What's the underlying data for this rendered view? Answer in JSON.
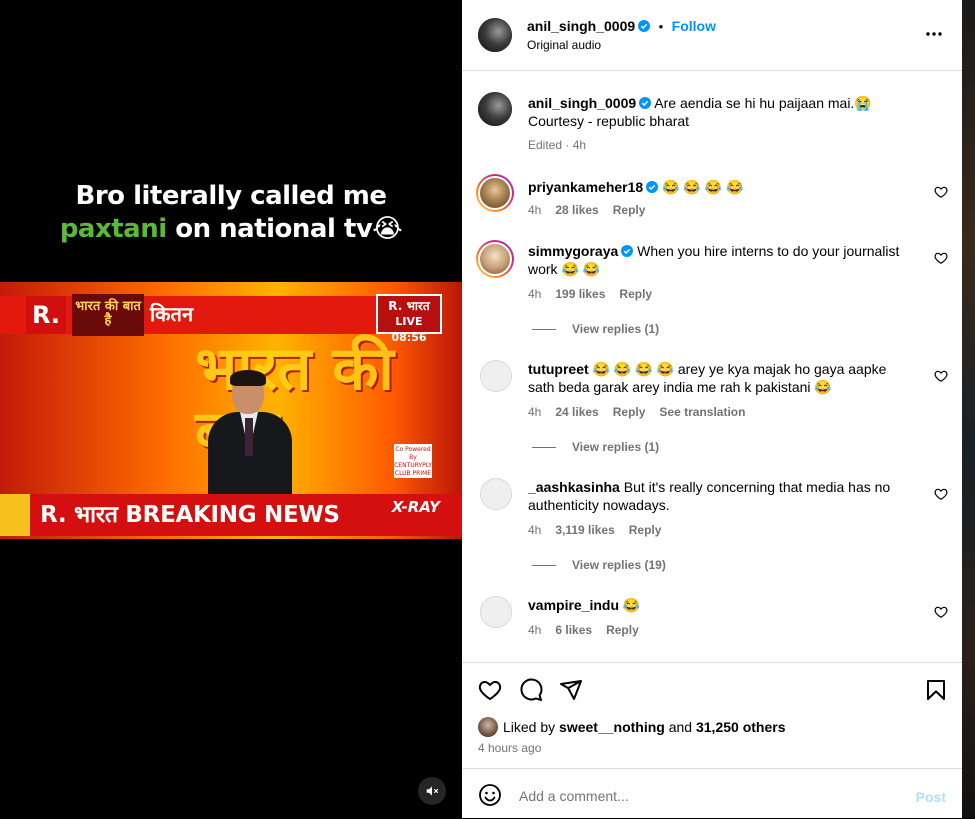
{
  "media": {
    "overlay_line1": "Bro literally called me",
    "overlay_highlight": "paxtani",
    "overlay_rest": "on national tv😭",
    "tv": {
      "logo": "R.",
      "brand": "भारत की बात है",
      "topic": "कितन",
      "live_channel": "R. भारत",
      "live_label": "LIVE",
      "live_time": "08:56",
      "big_text": "भारत की बात",
      "ticker": "R. भारत BREAKING NEWS",
      "xray": "X-RAY",
      "badge": "Co Powered By CENTURYPLY CLUB PRIME"
    },
    "mute_icon": "speaker-muted-icon"
  },
  "header": {
    "username": "anil_singh_0009",
    "separator": "•",
    "follow": "Follow",
    "audio": "Original audio",
    "more_icon": "more-horizontal-icon"
  },
  "caption": {
    "username": "anil_singh_0009",
    "text": "Are aendia se hi hu paijaan mai.😭",
    "line2": "Courtesy - republic bharat",
    "meta": "Edited · 4h"
  },
  "comments": [
    {
      "username": "priyankameher18",
      "text": "😂 😂 😂 😂",
      "time": "4h",
      "likes": "28 likes",
      "reply": "Reply"
    },
    {
      "username": "simmygoraya",
      "text": "When you hire interns to do your journalist work 😂 😂",
      "time": "4h",
      "likes": "199 likes",
      "reply": "Reply",
      "view_replies": "View replies (1)"
    },
    {
      "username": "tutupreet",
      "text": "😂 😂 😂 😂 arey ye kya majak ho gaya aapke sath beda garak arey india me rah k pakistani 😂",
      "time": "4h",
      "likes": "24 likes",
      "reply": "Reply",
      "translation": "See translation",
      "view_replies": "View replies (1)"
    },
    {
      "username": "_aashkasinha",
      "text": "But it's really concerning that media has no authenticity nowadays.",
      "time": "4h",
      "likes": "3,119 likes",
      "reply": "Reply",
      "view_replies": "View replies (19)"
    },
    {
      "username": "vampire_indu",
      "text": "😂",
      "time": "4h",
      "likes": "6 likes",
      "reply": "Reply"
    }
  ],
  "likes": {
    "prefix": "Liked by",
    "user": "sweet__nothing",
    "and": "and",
    "others": "31,250 others",
    "time": "4 hours ago"
  },
  "add_comment": {
    "placeholder": "Add a comment...",
    "post": "Post"
  },
  "colors": {
    "link": "#0095f6",
    "verified": "#0095f6",
    "muted": "#737373",
    "divider": "#dbdbdb",
    "highlight": "#5ab93a"
  }
}
